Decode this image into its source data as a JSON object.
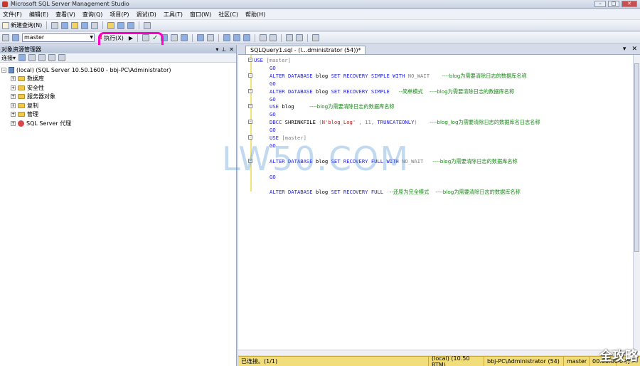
{
  "window": {
    "title": "Microsoft SQL Server Management Studio",
    "min": "–",
    "max": "□",
    "close": "✕"
  },
  "menu": [
    "文件(F)",
    "编辑(E)",
    "查看(V)",
    "查询(Q)",
    "项目(P)",
    "调试(D)",
    "工具(T)",
    "窗口(W)",
    "社区(C)",
    "帮助(H)"
  ],
  "toolbar": {
    "new_query": "新建查询(N)",
    "database": "master",
    "execute": "执行(X)"
  },
  "object_explorer": {
    "title": "对象资源管理器",
    "connect": "连接▾",
    "server": "(local) (SQL Server 10.50.1600 - bbj-PC\\Administrator)",
    "nodes": [
      "数据库",
      "安全性",
      "服务器对象",
      "复制",
      "管理",
      "SQL Server 代理"
    ]
  },
  "editor": {
    "tab_title": "SQLQuery1.sql - (l...dministrator (54))*",
    "lines": [
      {
        "parts": [
          [
            "kw",
            "USE "
          ],
          [
            "gr",
            "[master]"
          ]
        ]
      },
      {
        "parts": [
          [
            "kw",
            "GO"
          ]
        ]
      },
      {
        "parts": [
          [
            "kw",
            "ALTER DATABASE "
          ],
          [
            "plain",
            "blog "
          ],
          [
            "kw",
            "SET RECOVERY SIMPLE WITH "
          ],
          [
            "gr",
            "NO_WAIT"
          ],
          [
            "plain",
            "    "
          ],
          [
            "cm",
            "----blog为需要清除日志的数据库名称"
          ]
        ]
      },
      {
        "parts": [
          [
            "kw",
            "GO"
          ]
        ]
      },
      {
        "parts": [
          [
            "kw",
            "ALTER DATABASE "
          ],
          [
            "plain",
            "blog "
          ],
          [
            "kw",
            "SET RECOVERY SIMPLE"
          ],
          [
            "plain",
            "   "
          ],
          [
            "cm",
            "--简单模式    ----blog为需要清除日志的数据库名称"
          ]
        ]
      },
      {
        "parts": [
          [
            "kw",
            "GO"
          ]
        ]
      },
      {
        "parts": [
          [
            "kw",
            "USE "
          ],
          [
            "plain",
            "blog"
          ],
          [
            "plain",
            "     "
          ],
          [
            "cm",
            "----blog为需要清除日志的数据库名称"
          ]
        ]
      },
      {
        "parts": [
          [
            "kw",
            "GO"
          ]
        ]
      },
      {
        "parts": [
          [
            "kw",
            "DBCC "
          ],
          [
            "plain",
            "SHRINKFILE "
          ],
          [
            "gr",
            "("
          ],
          [
            "str",
            "N'blog_Log'"
          ],
          [
            "gr",
            " , 11, "
          ],
          [
            "kw",
            "TRUNCATEONLY"
          ],
          [
            "gr",
            ")"
          ],
          [
            "plain",
            "    "
          ],
          [
            "cm",
            "----blog_log为需要清除日志的数据库名日志名称"
          ]
        ]
      },
      {
        "parts": [
          [
            "kw",
            "GO"
          ]
        ]
      },
      {
        "parts": [
          [
            "kw",
            "USE "
          ],
          [
            "gr",
            "[master]"
          ]
        ]
      },
      {
        "parts": [
          [
            "kw",
            "GO"
          ]
        ]
      },
      {
        "parts": []
      },
      {
        "parts": [
          [
            "kw",
            "ALTER DATABASE "
          ],
          [
            "plain",
            "blog "
          ],
          [
            "kw",
            "SET RECOVERY FULL WITH "
          ],
          [
            "gr",
            "NO_WAIT"
          ],
          [
            "plain",
            "   "
          ],
          [
            "cm",
            "----blog为需要清除日志的数据库名称"
          ]
        ]
      },
      {
        "parts": []
      },
      {
        "parts": [
          [
            "kw",
            "GO"
          ]
        ]
      },
      {
        "parts": []
      },
      {
        "parts": [
          [
            "kw",
            "ALTER DATABASE "
          ],
          [
            "plain",
            "blog "
          ],
          [
            "kw",
            "SET RECOVERY FULL"
          ],
          [
            "plain",
            "  "
          ],
          [
            "cm",
            "--还原为完全模式    ----blog为需要清除日志的数据库名称"
          ]
        ]
      }
    ]
  },
  "status": {
    "connected": "已连接。(1/1)",
    "server": "(local) (10.50 RTM)",
    "user": "bbj-PC\\Administrator (54)",
    "db": "master",
    "time": "00:00:00",
    "rows": "0 行"
  },
  "watermark": "LW50.COM",
  "corner_mark": "全攻略"
}
